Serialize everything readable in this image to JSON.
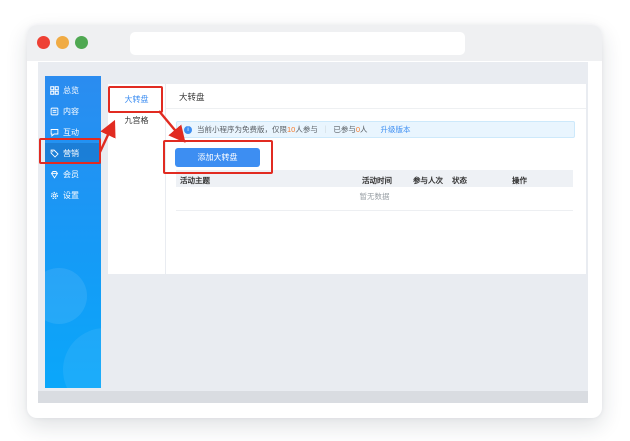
{
  "browser": {
    "traffic_lights": [
      "close",
      "minimize",
      "zoom"
    ],
    "address_placeholder": ""
  },
  "sidebar": {
    "items": [
      {
        "label": "总览",
        "icon": "grid-overview-icon",
        "active": false
      },
      {
        "label": "内容",
        "icon": "content-list-icon",
        "active": false
      },
      {
        "label": "互动",
        "icon": "interaction-chat-icon",
        "active": false
      },
      {
        "label": "营销",
        "icon": "marketing-tag-icon",
        "active": true
      },
      {
        "label": "会员",
        "icon": "member-vip-icon",
        "active": false
      },
      {
        "label": "设置",
        "icon": "settings-gear-icon",
        "active": false
      }
    ]
  },
  "subnav": {
    "items": [
      {
        "label": "大转盘",
        "active": true
      },
      {
        "label": "九宫格",
        "active": false
      }
    ]
  },
  "page": {
    "title": "大转盘"
  },
  "notice": {
    "info_icon": "i",
    "text_prefix": "当前小程序为免费版，仅限",
    "limit_count": "10",
    "text_mid": "人参与",
    "separator": "｜",
    "joined_label": "已参与",
    "joined_count": "0",
    "joined_suffix": "人",
    "upgrade_link": "升级版本"
  },
  "toolbar": {
    "add_button": "添加大转盘"
  },
  "table": {
    "headers": [
      "活动主题",
      "活动时间",
      "参与人次",
      "状态",
      "操作"
    ],
    "empty_text": "暂无数据"
  },
  "annotations": {
    "highlight_color": "#e12b21",
    "targets": [
      "sidebar-marketing",
      "subnav-dazhuanpan",
      "add-button"
    ]
  },
  "colors": {
    "accent_blue": "#3d8ef2",
    "sidebar_gradient_top": "#2b8cf0",
    "sidebar_gradient_bottom": "#0aa7fa",
    "notice_bg": "#e9f5fe",
    "highlight_orange": "#fa7b2a",
    "traffic_red": "#ee4034",
    "traffic_yellow": "#f0ab44",
    "traffic_green": "#4fa852"
  }
}
